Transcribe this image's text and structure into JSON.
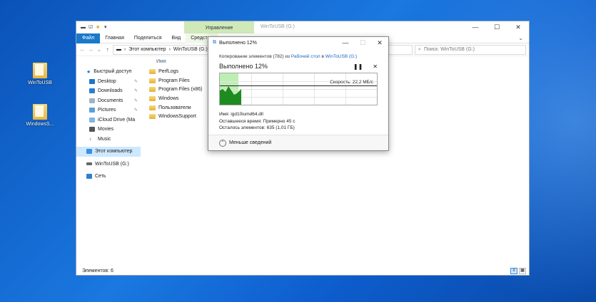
{
  "desktop": {
    "icons": [
      {
        "label": "WinToUSB"
      },
      {
        "label": "WindowsS..."
      }
    ]
  },
  "explorer": {
    "manage_tab": "Управление",
    "title": "WinToUSB (G:)",
    "ribbon_tabs": [
      "Файл",
      "Главная",
      "Поделиться",
      "Вид",
      "Средства"
    ],
    "address": {
      "segments": [
        "Этот компьютер",
        "WinToUSB (G:)"
      ]
    },
    "search_placeholder": "Поиск: WinToUSB (G:)",
    "nav": {
      "quick_access": "Быстрый доступ",
      "items": [
        "Desktop",
        "Downloads",
        "Documents",
        "Pictures",
        "iCloud Drive (Ma",
        "Movies",
        "Music"
      ],
      "this_pc": "Этот компьютер",
      "drive": "WinToUSB (G:)",
      "network": "Сеть"
    },
    "column_name": "Имя",
    "files": [
      "PerfLogs",
      "Program Files",
      "Program Files (x86)",
      "Windows",
      "Пользователи",
      "WindowsSupport"
    ],
    "status": "Элементов: 6"
  },
  "dialog": {
    "title": "Выполнено 12%",
    "copy_prefix": "Копирование элементов (782) из",
    "source": "Рабочий стол",
    "copy_mid": "в",
    "dest": "WinToUSB (G:)",
    "progress_text": "Выполнено 12%",
    "progress": 0.12,
    "speed": "Скорость: 22,2 МБ/с",
    "name_label": "Имя:",
    "name_value": "igd10iumd64.dll",
    "time_label": "Оставшееся время:",
    "time_value": "Примерно 45 с",
    "remaining_label": "Осталось элементов:",
    "remaining_value": "635 (1,01 ГБ)",
    "less_details": "Меньше сведений"
  },
  "colors": {
    "accent": "#1979ca",
    "progress_fill": "#bdefb4",
    "graph_area": "#1f8a1f",
    "manage_tab": "#cfe9b8"
  }
}
